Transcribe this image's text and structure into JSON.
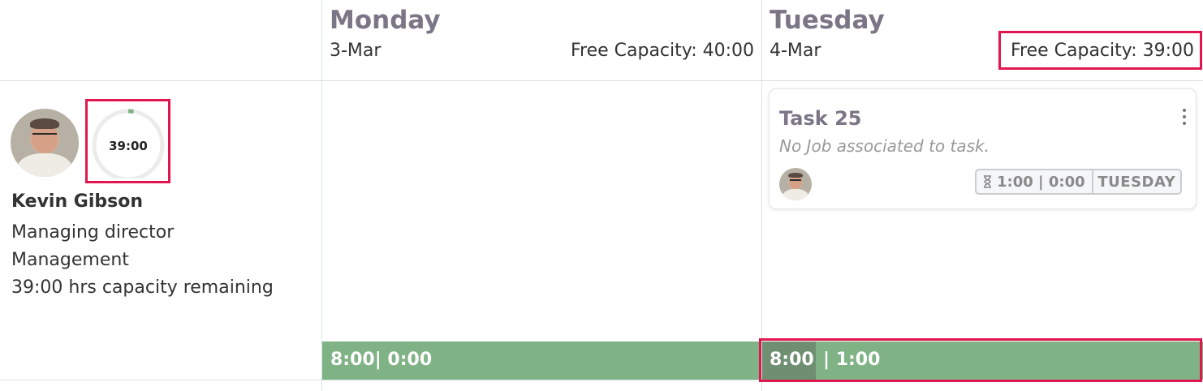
{
  "days": [
    {
      "name": "Monday",
      "date": "3-Mar",
      "free_capacity": "Free Capacity: 40:00",
      "summary": "8:00| 0:00"
    },
    {
      "name": "Tuesday",
      "date": "4-Mar",
      "free_capacity": "Free Capacity: 39:00",
      "summary_used": "8:00",
      "summary_rest": "| 1:00"
    }
  ],
  "person": {
    "capacity_ring": "39:00",
    "capacity_fraction_used": 0.025,
    "name": "Kevin Gibson",
    "role": "Managing director",
    "department": "Management",
    "capacity_text": "39:00 hrs capacity remaining"
  },
  "task": {
    "title": "Task 25",
    "subtitle": "No Job associated to task.",
    "hours": "1:00 | 0:00",
    "day_tag": "TUESDAY",
    "menu_icon": "kebab-menu-icon",
    "duration_icon": "hourglass-icon"
  },
  "colors": {
    "highlight": "#e0174f",
    "bar": "#7fb285",
    "bar_used": "#6f8f73",
    "ring_progress": "#7fb285",
    "heading": "#7a7686"
  }
}
